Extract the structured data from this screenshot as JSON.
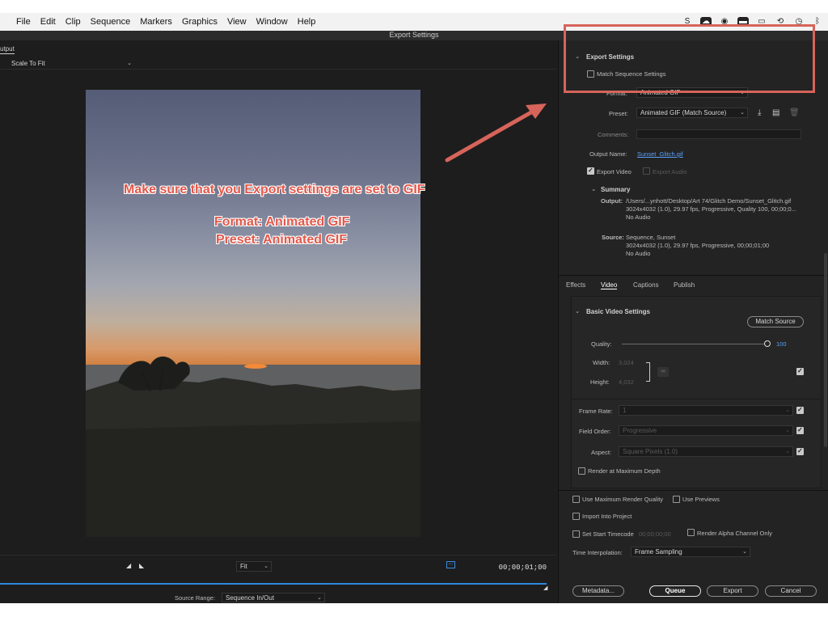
{
  "menubar": {
    "items": [
      "File",
      "Edit",
      "Clip",
      "Sequence",
      "Markers",
      "Graphics",
      "View",
      "Window",
      "Help"
    ],
    "tray_icons": [
      "dropbox-icon",
      "creative-cloud-icon",
      "screen-record-icon",
      "display-icon",
      "cast-icon",
      "sync-icon",
      "time-machine-icon",
      "bluetooth-icon"
    ]
  },
  "window": {
    "title": "Export Settings"
  },
  "left": {
    "tab": "utput",
    "scale_dropdown": "Scale To Fit",
    "annotation": {
      "line1": "Make sure that you Export settings are set to GIF",
      "line2": "Format: Animated GIF",
      "line3": "Preset: Animated GIF"
    },
    "timeline": {
      "fit_label": "Fit",
      "timecode": "00;00;01;00",
      "source_range_label": "Source Range:",
      "source_range_value": "Sequence In/Out"
    }
  },
  "export": {
    "section_title": "Export Settings",
    "match_sequence": "Match Sequence Settings",
    "format_label": "Format:",
    "format_value": "Animated GIF",
    "preset_label": "Preset:",
    "preset_value": "Animated GIF (Match Source)",
    "comments_label": "Comments:",
    "output_name_label": "Output Name:",
    "output_name_value": "Sunset_Glitch.gif",
    "export_video": "Export Video",
    "export_audio": "Export Audio",
    "summary_title": "Summary",
    "output_label": "Output:",
    "output_line1": "/Users/...ynhott/Desktop/Art 74/Glitch Demo/Sunset_Glitch.gif",
    "output_line2": "3024x4032 (1.0), 29.97 fps, Progressive, Quality 100, 00;00;0...",
    "output_line3": "No Audio",
    "source_label": "Source:",
    "source_line1": "Sequence, Sunset",
    "source_line2": "3024x4032 (1.0), 29.97 fps, Progressive, 00;00;01;00",
    "source_line3": "No Audio"
  },
  "tabs": [
    "Effects",
    "Video",
    "Captions",
    "Publish"
  ],
  "video": {
    "section_title": "Basic Video Settings",
    "match_source": "Match Source",
    "quality_label": "Quality:",
    "quality_value": "100",
    "quality_level": 1.0,
    "width_label": "Width:",
    "width_value": "3,024",
    "height_label": "Height:",
    "height_value": "4,032",
    "frame_rate_label": "Frame Rate:",
    "frame_rate_value": "1",
    "field_order_label": "Field Order:",
    "field_order_value": "Progressive",
    "aspect_label": "Aspect:",
    "aspect_value": "Square Pixels (1.0)",
    "render_max_depth": "Render at Maximum Depth"
  },
  "bottom": {
    "max_render_quality": "Use Maximum Render Quality",
    "use_previews": "Use Previews",
    "import_into_project": "Import Into Project",
    "set_start_timecode": "Set Start Timecode",
    "start_timecode_value": "00;00;00;00",
    "render_alpha": "Render Alpha Channel Only",
    "time_interp_label": "Time Interpolation:",
    "time_interp_value": "Frame Sampling",
    "metadata": "Metadata...",
    "queue": "Queue",
    "export": "Export",
    "cancel": "Cancel"
  },
  "colors": {
    "accent": "#2e89e0",
    "annotation": "#e4574a",
    "highlight_box": "#d7645a"
  }
}
